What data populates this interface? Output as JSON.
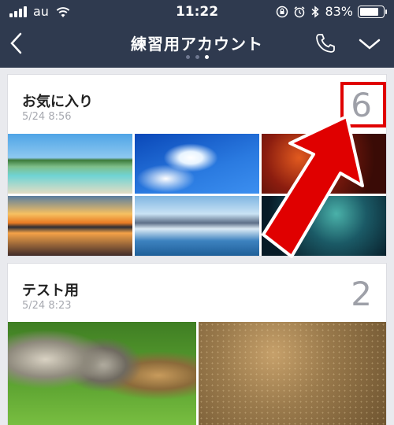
{
  "status_bar": {
    "carrier": "au",
    "time": "11:22",
    "battery": "83%",
    "battery_level": 0.83
  },
  "nav": {
    "title": "練習用アカウント",
    "page_dots": 3,
    "active_dot": 2
  },
  "albums": [
    {
      "title": "お気に入り",
      "date": "5/24 8:56",
      "count": "6",
      "thumbnails": [
        "beach",
        "blue-sky-clouds",
        "red-nebula",
        "sunset-reflection",
        "mountain-lake",
        "starry-sky"
      ]
    },
    {
      "title": "テスト用",
      "date": "5/24 8:23",
      "count": "2",
      "thumbnails": [
        "kittens",
        "gold-texture"
      ]
    }
  ],
  "annotation": {
    "color": "#e00000"
  },
  "colors": {
    "header_bg": "#2f3a4f",
    "page_bg": "#e9eaee",
    "count_text": "#9ea0a8"
  }
}
